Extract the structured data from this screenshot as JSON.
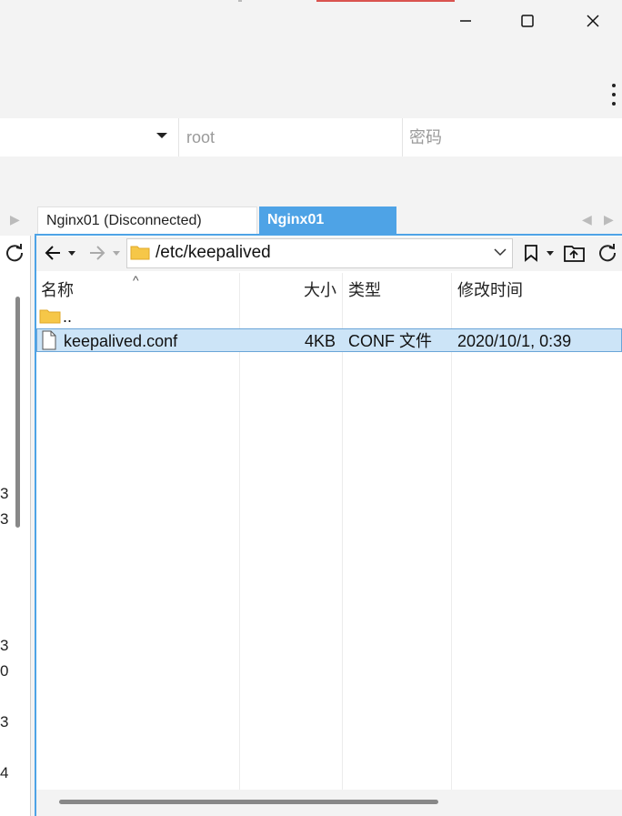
{
  "connection": {
    "user_value": "root",
    "password_placeholder": "密码"
  },
  "tabs": [
    {
      "label": "Nginx01 (Disconnected)",
      "active": false
    },
    {
      "label": "Nginx01",
      "active": true
    }
  ],
  "file_browser": {
    "path": "/etc/keepalived",
    "columns": [
      "名称",
      "大小",
      "类型",
      "修改时间"
    ],
    "rows": [
      {
        "name": "..",
        "size": "",
        "type": "",
        "modified": "",
        "icon": "folder-icon"
      },
      {
        "name": "keepalived.conf",
        "size": "4KB",
        "type": "CONF 文件",
        "modified": "2020/10/1, 0:39",
        "icon": "file-icon",
        "selected": true
      }
    ]
  },
  "left_panel_fragments": [
    "3",
    "3",
    "3",
    "0",
    "3",
    "4"
  ],
  "colors": {
    "accent": "#4ea3e6",
    "selection": "#cce4f7",
    "window_close_strip": "#d9534f"
  }
}
